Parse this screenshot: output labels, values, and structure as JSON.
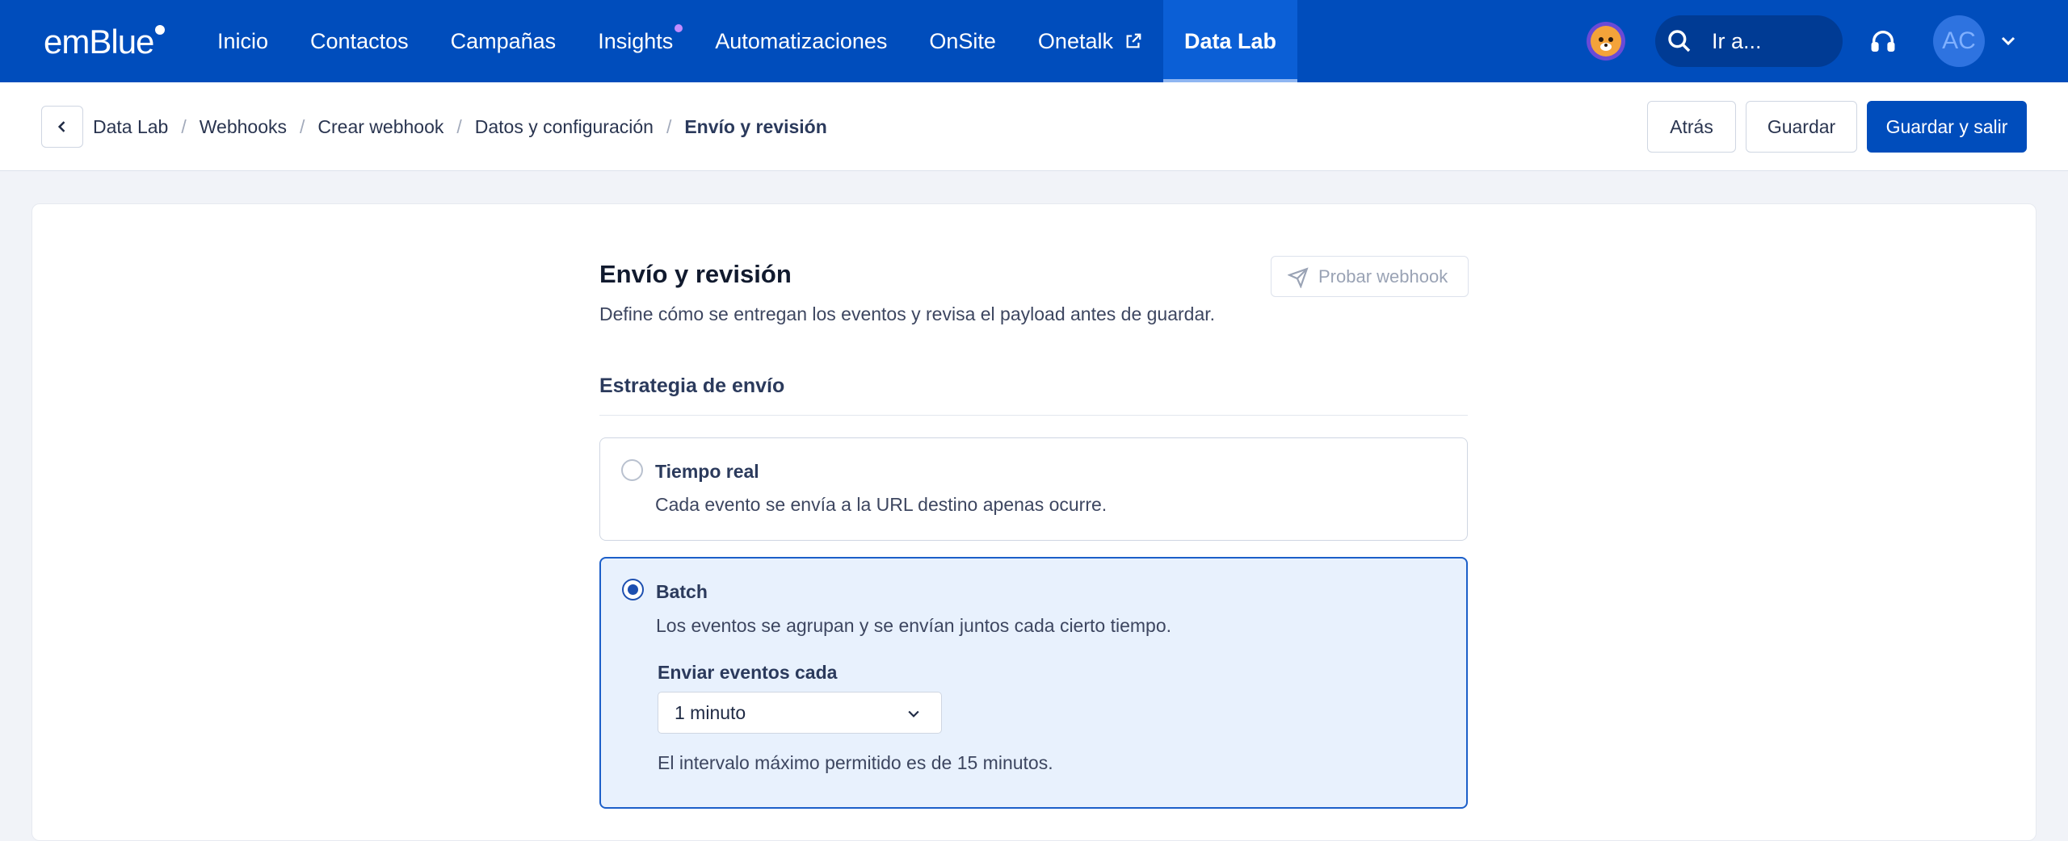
{
  "nav": {
    "logo": "emBlue",
    "items": [
      {
        "label": "Inicio"
      },
      {
        "label": "Contactos"
      },
      {
        "label": "Campañas"
      },
      {
        "label": "Insights"
      },
      {
        "label": "Automatizaciones"
      },
      {
        "label": "OnSite"
      },
      {
        "label": "Onetalk"
      },
      {
        "label": "Data Lab"
      }
    ],
    "active": "Data Lab",
    "goto_label": "Ir a...",
    "avatar_initials": "AC"
  },
  "breadcrumb": {
    "items": [
      "Data Lab",
      "Webhooks",
      "Crear webhook",
      "Datos y configuración",
      "Envío y revisión"
    ],
    "separator": "/"
  },
  "actions": {
    "back": "Atrás",
    "save": "Guardar",
    "save_exit": "Guardar y salir"
  },
  "section": {
    "title": "Envío y revisión",
    "subtitle": "Define cómo se entregan los eventos y revisa el payload antes de guardar.",
    "test_button": "Probar webhook",
    "strategy_title": "Estrategia de envío"
  },
  "options": {
    "realtime": {
      "title": "Tiempo real",
      "desc": "Cada evento se envía a la URL destino apenas ocurre.",
      "selected": false
    },
    "batch": {
      "title": "Batch",
      "desc": "Los eventos se agrupan y se envían juntos cada cierto tiempo.",
      "selected": true,
      "field_label": "Enviar eventos cada",
      "interval_value": "1 minuto",
      "hint": "El intervalo máximo permitido es de 15 minutos."
    }
  },
  "colors": {
    "nav_bg": "#004dbc",
    "primary": "#004dbc",
    "selected_bg": "#e8f1fd",
    "selected_border": "#1c5fc9"
  }
}
